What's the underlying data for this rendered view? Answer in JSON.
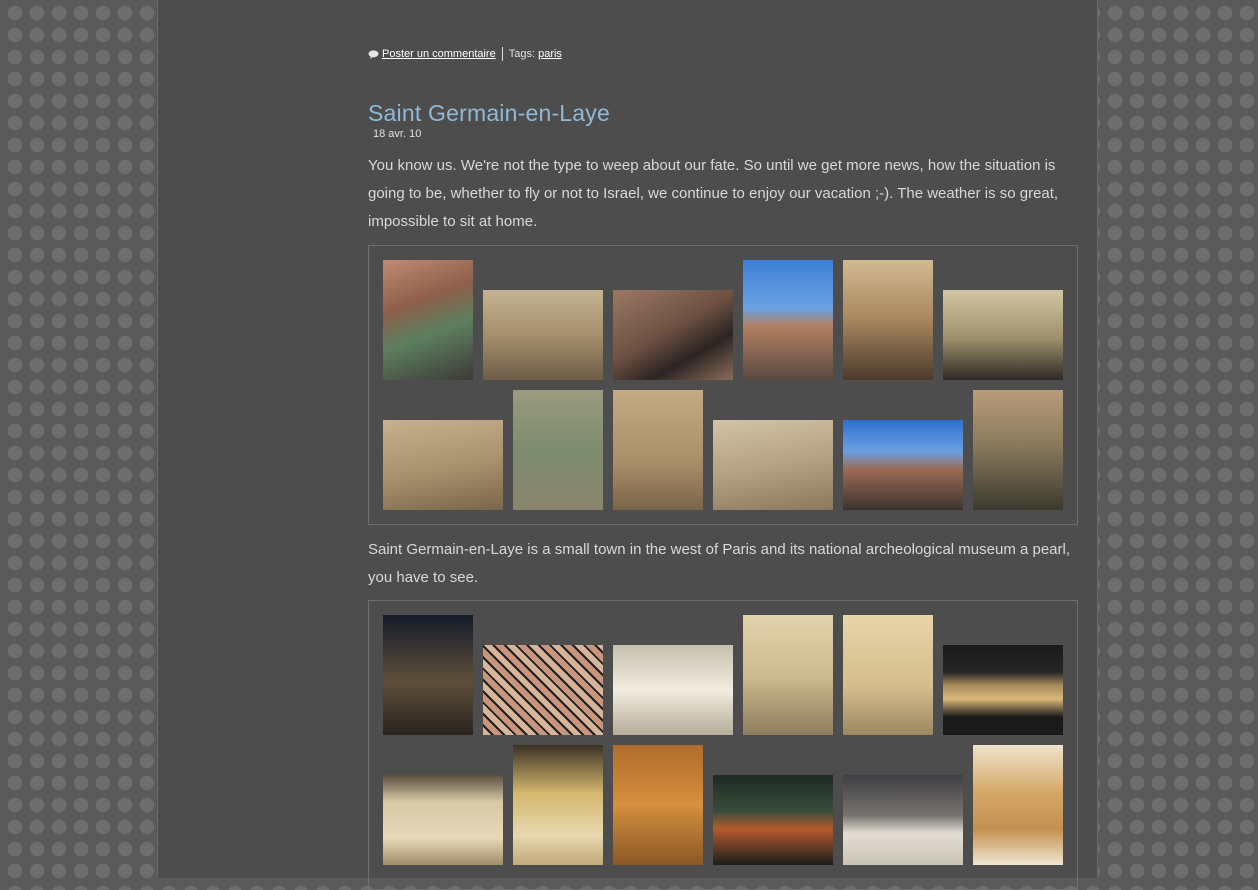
{
  "post_meta": {
    "comment_link": "Poster un commentaire",
    "tags_label": "Tags:",
    "tag": "paris"
  },
  "post": {
    "title": "Saint Germain-en-Laye",
    "date": "18 avr. 10",
    "intro": "You know us. We're not the type to weep about our fate. So until we get more news, how the situation is going to be, whether to fly or not to Israel, we continue to enjoy our vacation ;-). The weather is so great, impossible to sit at home.",
    "second_paragraph": "Saint Germain-en-Laye is a small town in the west of Paris and its national archeological museum a pearl, you have to see."
  },
  "gallery_1": {
    "photos": [
      "church-exterior-photo",
      "rose-window-photo",
      "museum-facade-photo",
      "castle-courtyard-photo",
      "gothic-windows-photo",
      "chapel-interior-photo",
      "stone-inscription-photo",
      "garden-model-photo",
      "red-inscription-photo",
      "carved-stone-photo",
      "courtyard-arcades-photo",
      "chapel-windows-photo"
    ]
  },
  "gallery_2": {
    "photos": [
      "antler-exhibit-photo",
      "stained-glass-photo",
      "visit-start-sign-photo",
      "flint-tools-photo",
      "stone-tools-photo",
      "paleolithic-sign-photo",
      "label-list-photo",
      "fire-production-photo",
      "domestication-panel-photo",
      "bronze-age-photo",
      "display-case-photo",
      "arrowheads-photo"
    ]
  }
}
